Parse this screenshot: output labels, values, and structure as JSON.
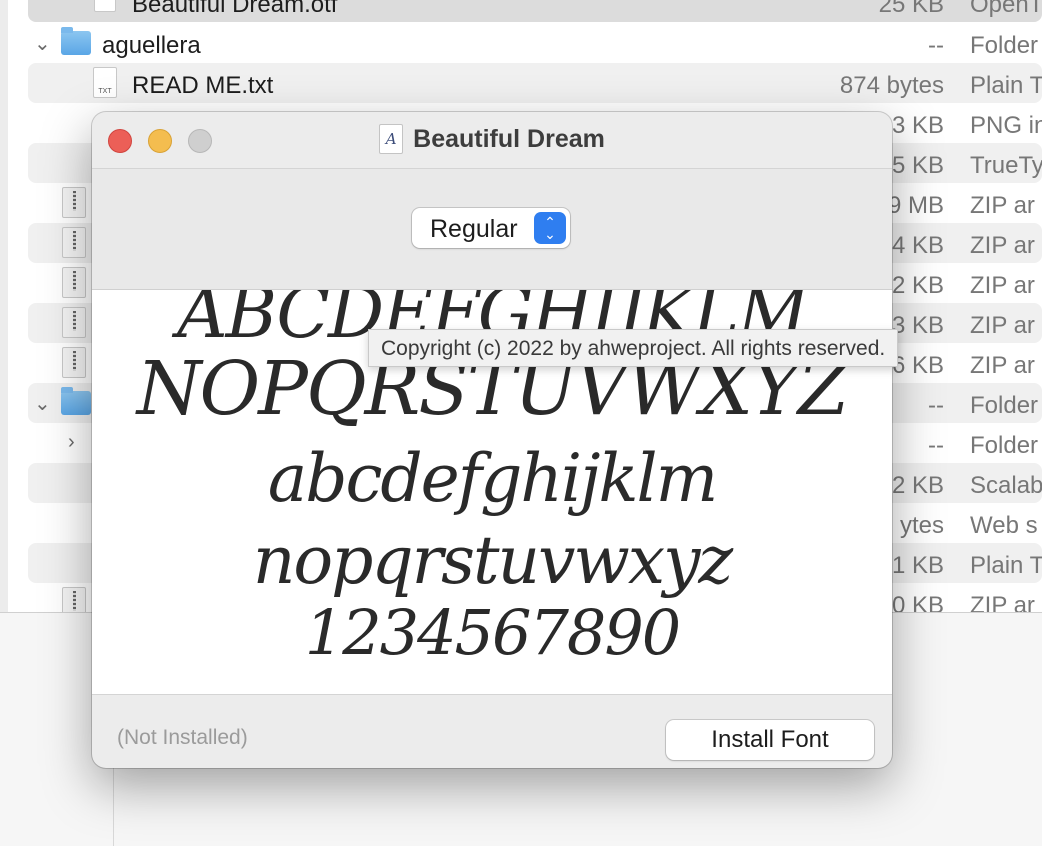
{
  "finder": {
    "rows": [
      {
        "name": "Beautiful Dream.otf",
        "size": "25 KB",
        "kind": "OpenT"
      },
      {
        "name": "aguellera",
        "size": "--",
        "kind": "Folder"
      },
      {
        "name": "READ ME.txt",
        "size": "874 bytes",
        "kind": "Plain T"
      },
      {
        "size": "3 KB",
        "kind": "PNG in"
      },
      {
        "size": "5 KB",
        "kind": "TrueTy"
      },
      {
        "size": "9 MB",
        "kind": "ZIP ar"
      },
      {
        "size": "4 KB",
        "kind": "ZIP ar"
      },
      {
        "size": "2 KB",
        "kind": "ZIP ar"
      },
      {
        "size": "3 KB",
        "kind": "ZIP ar"
      },
      {
        "size": "6 KB",
        "kind": "ZIP ar"
      },
      {
        "size": "--",
        "kind": "Folder"
      },
      {
        "size": "--",
        "kind": "Folder"
      },
      {
        "size": "2 KB",
        "kind": "Scalab"
      },
      {
        "size": "ytes",
        "kind": "Web s"
      },
      {
        "size": "1 KB",
        "kind": "Plain T"
      },
      {
        "size": "0 KB",
        "kind": "ZIP ar"
      }
    ],
    "icon_labels": {
      "font": "A",
      "txt": "TXT"
    }
  },
  "font_window": {
    "title": "Beautiful Dream",
    "title_icon_glyph": "A",
    "style_popup": {
      "selected": "Regular",
      "up_arrow": "⌃",
      "down_arrow": "⌄"
    },
    "sample_lines": [
      "ABCDEFGHIJKLM",
      "NOPQRSTUVWXYZ",
      "abcdefghijklm",
      "nopqrstuvwxyz",
      "1234567890"
    ],
    "tooltip": "Copyright (c) 2022 by ahweproject. All rights reserved.",
    "status": "(Not Installed)",
    "install_button": "Install Font"
  },
  "colors": {
    "close": "#ec5f57",
    "minimize": "#f4bd4f",
    "zoom_disabled": "#cfcfcf",
    "accent": "#2f7ef0",
    "folder": "#5aa6e6"
  }
}
